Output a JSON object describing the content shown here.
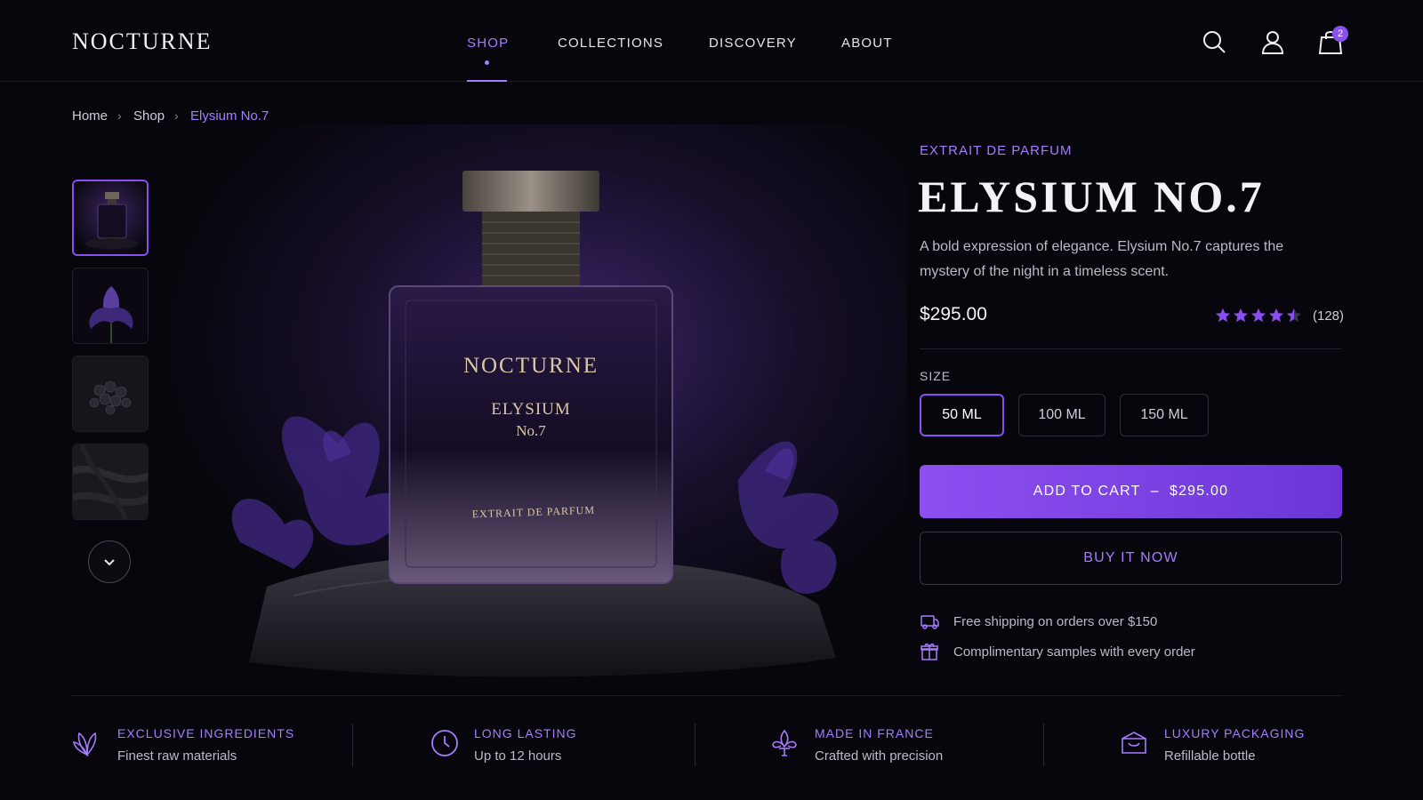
{
  "brand": {
    "logo": "NOCTURNE"
  },
  "nav": {
    "items": [
      "SHOP",
      "COLLECTIONS",
      "DISCOVERY",
      "ABOUT"
    ],
    "active": "SHOP"
  },
  "header": {
    "cart_count": "2",
    "icons": [
      "search-icon",
      "account-icon",
      "shopping-bag-icon"
    ]
  },
  "breadcrumb": {
    "items": [
      "Home",
      "Shop",
      "Elysium No.7"
    ],
    "separator": "›"
  },
  "gallery": {
    "thumbnails": [
      "bottle",
      "iris-flower",
      "black-berries",
      "dark-texture"
    ],
    "selected": 0,
    "bottle_label": {
      "brand": "NOCTURNE",
      "name": "ELYSIUM",
      "number": "No.7",
      "type": "EXTRAIT DE PARFUM"
    }
  },
  "product": {
    "eyebrow": "EXTRAIT DE PARFUM",
    "title": "ELYSIUM NO.7",
    "description": "A bold expression of elegance. Elysium No.7 captures the mystery of the night in a timeless scent.",
    "price": "$295.00",
    "rating": 4.5,
    "rating_count": "(128)",
    "size_label": "SIZE",
    "sizes": [
      "50 ML",
      "100 ML",
      "150 ML"
    ],
    "selected_size": "50 ML",
    "add_to_cart": "ADD TO CART  –  $295.00",
    "buy_now": "BUY IT NOW",
    "perks": [
      "Free shipping on orders over $150",
      "Complimentary samples with every order"
    ]
  },
  "features": [
    {
      "title": "EXCLUSIVE INGREDIENTS",
      "subtitle": "Finest raw materials",
      "icon": "leaf-icon"
    },
    {
      "title": "LONG LASTING",
      "subtitle": "Up to 12 hours",
      "icon": "clock-icon"
    },
    {
      "title": "MADE IN FRANCE",
      "subtitle": "Crafted with precision",
      "icon": "fleur-de-lis-icon"
    },
    {
      "title": "LUXURY PACKAGING",
      "subtitle": "Refillable bottle",
      "icon": "gift-box-icon"
    }
  ],
  "colors": {
    "accent": "#8a4ff2",
    "accent_text": "#a67cff",
    "background": "#07060c"
  }
}
